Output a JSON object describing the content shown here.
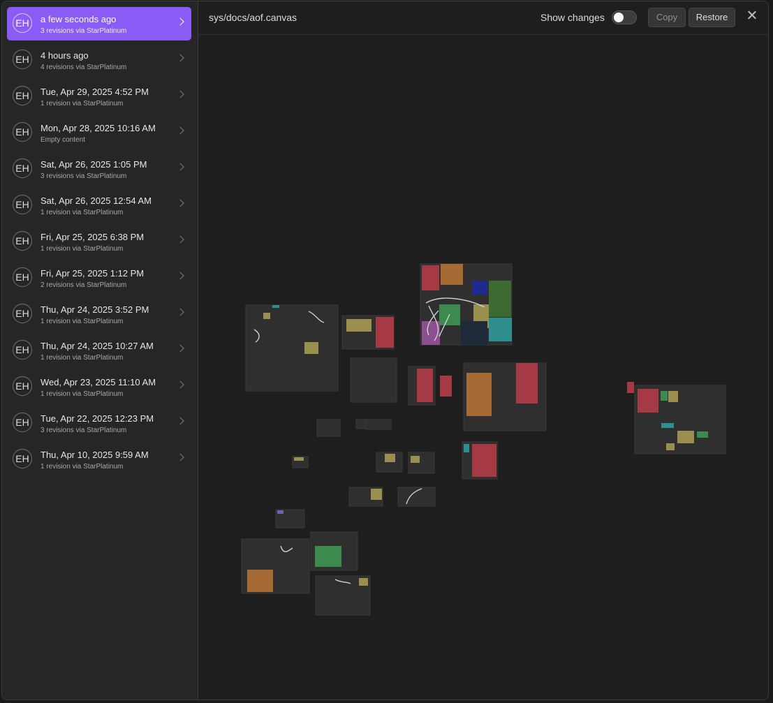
{
  "file_path": "sys/docs/aof.canvas",
  "header": {
    "show_changes_label": "Show changes",
    "show_changes_on": false,
    "copy_label": "Copy",
    "restore_label": "Restore"
  },
  "revisions": [
    {
      "initials": "EH",
      "title": "a few seconds ago",
      "subtitle": "3 revisions via StarPlatinum",
      "active": true
    },
    {
      "initials": "EH",
      "title": "4 hours ago",
      "subtitle": "4 revisions via StarPlatinum"
    },
    {
      "initials": "EH",
      "title": "Tue, Apr 29, 2025 4:52 PM",
      "subtitle": "1 revision via StarPlatinum"
    },
    {
      "initials": "EH",
      "title": "Mon, Apr 28, 2025 10:16 AM",
      "subtitle": "Empty content"
    },
    {
      "initials": "EH",
      "title": "Sat, Apr 26, 2025 1:05 PM",
      "subtitle": "3 revisions via StarPlatinum"
    },
    {
      "initials": "EH",
      "title": "Sat, Apr 26, 2025 12:54 AM",
      "subtitle": "1 revision via StarPlatinum"
    },
    {
      "initials": "EH",
      "title": "Fri, Apr 25, 2025 6:38 PM",
      "subtitle": "1 revision via StarPlatinum"
    },
    {
      "initials": "EH",
      "title": "Fri, Apr 25, 2025 1:12 PM",
      "subtitle": "2 revisions via StarPlatinum"
    },
    {
      "initials": "EH",
      "title": "Thu, Apr 24, 2025 3:52 PM",
      "subtitle": "1 revision via StarPlatinum"
    },
    {
      "initials": "EH",
      "title": "Thu, Apr 24, 2025 10:27 AM",
      "subtitle": "1 revision via StarPlatinum"
    },
    {
      "initials": "EH",
      "title": "Wed, Apr 23, 2025 11:10 AM",
      "subtitle": "1 revision via StarPlatinum"
    },
    {
      "initials": "EH",
      "title": "Tue, Apr 22, 2025 12:23 PM",
      "subtitle": "3 revisions via StarPlatinum"
    },
    {
      "initials": "EH",
      "title": "Thu, Apr 10, 2025 9:59 AM",
      "subtitle": "1 revision via StarPlatinum"
    }
  ],
  "icons": {
    "close": "close-icon",
    "chevron": "chevron-right-icon"
  },
  "colors": {
    "accent": "#8a5cf5",
    "card_red": "#a63a44",
    "card_orange": "#a66a34",
    "card_green": "#3d8a4f",
    "card_yellow": "#9a8f4e",
    "card_teal": "#2f8f8f"
  }
}
